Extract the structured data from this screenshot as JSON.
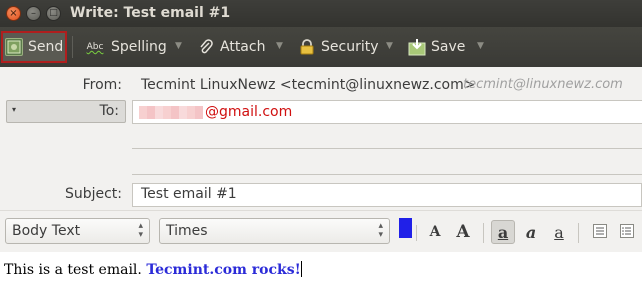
{
  "window": {
    "title": "Write: Test email #1",
    "controls": {
      "close": "×",
      "minimize": "–",
      "maximize": "□"
    }
  },
  "toolbar": {
    "send_label": "Send",
    "spelling_label": "Spelling",
    "attach_label": "Attach",
    "security_label": "Security",
    "save_label": "Save",
    "spelling_icon_text": "Abc",
    "dropdown_glyph": "▼"
  },
  "header": {
    "from_label": "From:",
    "from_value": "Tecmint LinuxNewz <tecmint@linuxnewz.com>",
    "from_hint": "tecmint@linuxnewz.com",
    "to_label": "To:",
    "to_value": "@gmail.com",
    "subject_label": "Subject:",
    "subject_value": "Test email #1"
  },
  "format": {
    "paragraph_style": "Body Text",
    "font": "Times",
    "text_color": "#2020e8",
    "styles": [
      "A",
      "A",
      "a",
      "a",
      "a"
    ]
  },
  "body": {
    "text_plain": "This is a test email. ",
    "text_link": "Tecmint.com rocks!"
  },
  "colors": {
    "accent_red": "#b01e1e",
    "recipient_red": "#d01010",
    "link_blue": "#2b2bd8"
  }
}
